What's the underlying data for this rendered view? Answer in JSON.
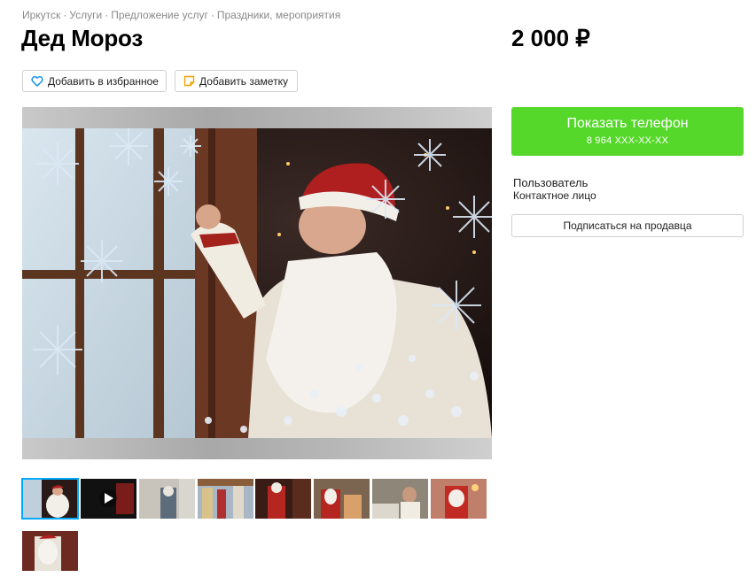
{
  "breadcrumbs": [
    "Иркутск",
    "Услуги",
    "Предложение услуг",
    "Праздники, мероприятия"
  ],
  "breadcrumb_separator": "·",
  "listing": {
    "title": "Дед Мороз",
    "price": "2 000 ₽"
  },
  "actions": {
    "favorite_label": "Добавить в избранное",
    "note_label": "Добавить заметку"
  },
  "contact": {
    "show_phone_label": "Показать телефон",
    "phone_masked": "8 964 XXX-XX-XX",
    "seller_name": "Пользователь",
    "seller_role": "Контактное лицо",
    "subscribe_label": "Подписаться на продавца"
  },
  "colors": {
    "accent_green": "#56d82b",
    "active_thumb": "#00aaff"
  },
  "gallery": {
    "count": 9,
    "active_index": 0,
    "video_index": 1
  }
}
